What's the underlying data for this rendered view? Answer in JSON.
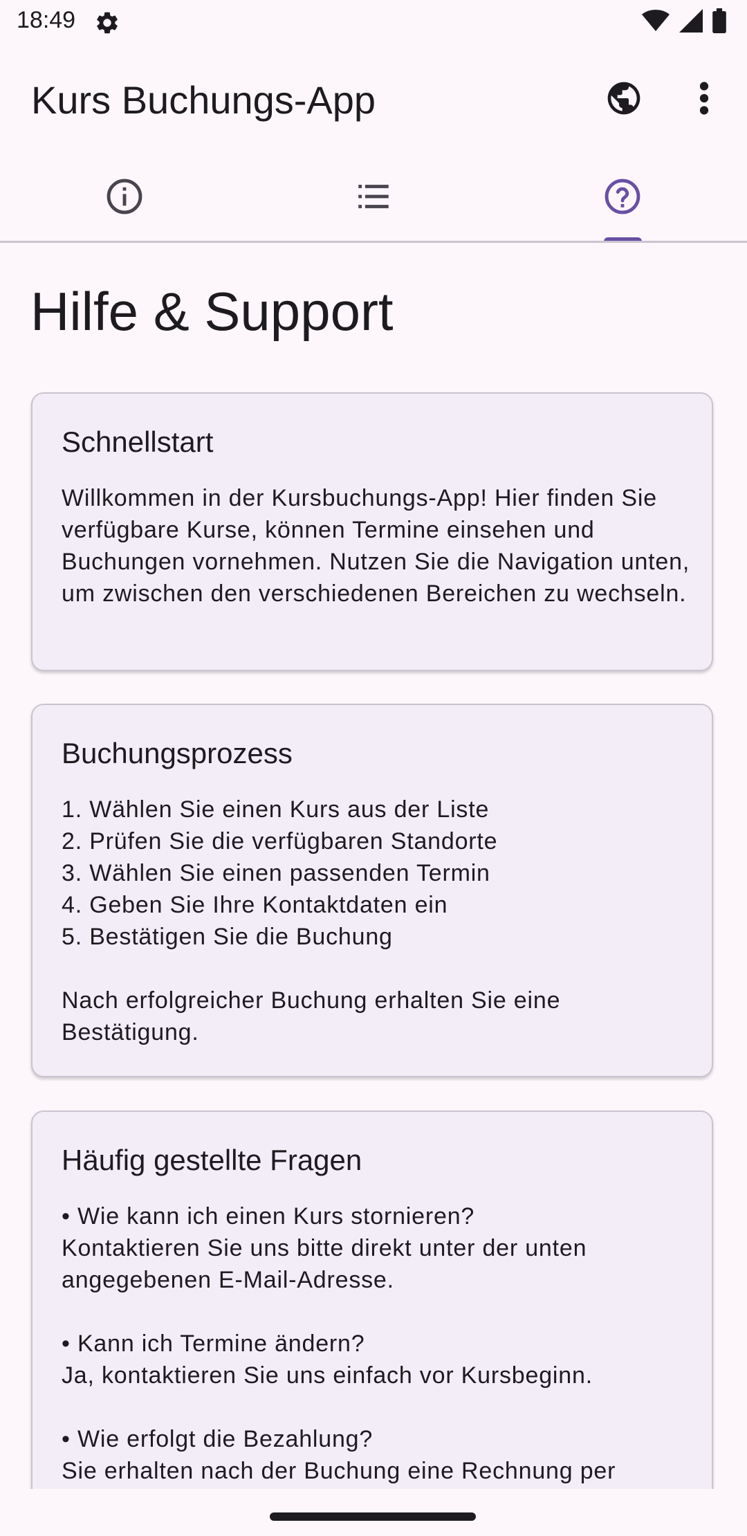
{
  "status_bar": {
    "time": "18:49",
    "icons": [
      "gear-icon",
      "wifi-icon",
      "signal-icon",
      "battery-icon"
    ]
  },
  "app_bar": {
    "title": "Kurs Buchungs-App",
    "actions": [
      "globe-icon",
      "more-vert-icon"
    ]
  },
  "tabs": [
    {
      "icon": "info-icon",
      "selected": false
    },
    {
      "icon": "list-icon",
      "selected": false
    },
    {
      "icon": "help-icon",
      "selected": true
    }
  ],
  "colors": {
    "accent": "#6750a4",
    "background": "#fdf7fb",
    "card_background": "#f3edf7",
    "text": "#1d1b20",
    "icon": "#49454f"
  },
  "page": {
    "title": "Hilfe & Support"
  },
  "cards": [
    {
      "title": "Schnellstart",
      "body": "Willkommen in der Kursbuchungs-App! Hier finden Sie verfügbare Kurse, können Termine einsehen und Buchungen vornehmen. Nutzen Sie die Navigation unten, um zwischen den verschiedenen Bereichen zu wechseln."
    },
    {
      "title": "Buchungsprozess",
      "body": "1. Wählen Sie einen Kurs aus der Liste\n2. Prüfen Sie die verfügbaren Standorte\n3. Wählen Sie einen passenden Termin\n4. Geben Sie Ihre Kontaktdaten ein\n5. Bestätigen Sie die Buchung\n\nNach erfolgreicher Buchung erhalten Sie eine Bestätigung."
    },
    {
      "title": "Häufig gestellte Fragen",
      "body": "• Wie kann ich einen Kurs stornieren?\nKontaktieren Sie uns bitte direkt unter der unten angegebenen E-Mail-Adresse.\n\n• Kann ich Termine ändern?\nJa, kontaktieren Sie uns einfach vor Kursbeginn.\n\n• Wie erfolgt die Bezahlung?\nSie erhalten nach der Buchung eine Rechnung per"
    }
  ]
}
